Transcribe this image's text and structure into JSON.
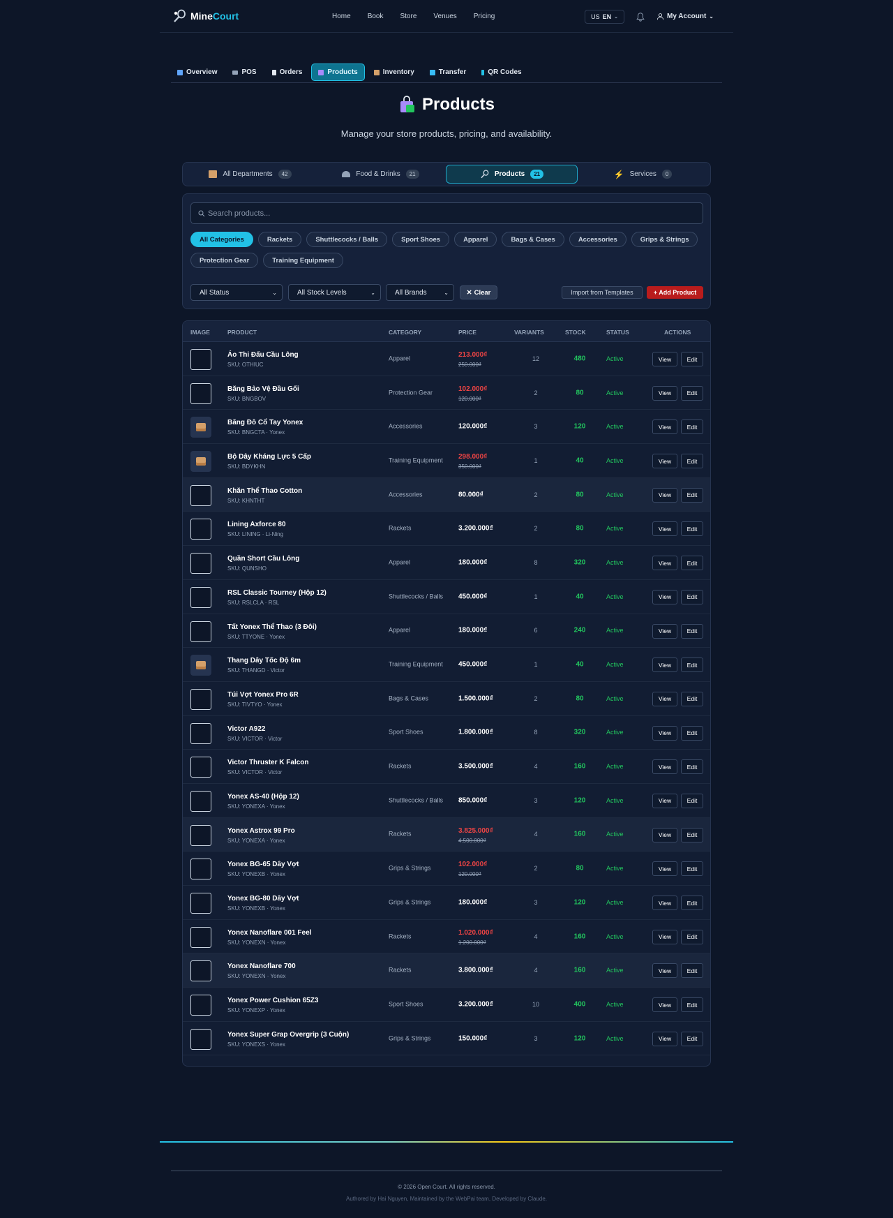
{
  "brand": {
    "name_a": "Mine",
    "name_b": "Court"
  },
  "nav": {
    "links": [
      "Home",
      "Book",
      "Store",
      "Venues",
      "Pricing"
    ],
    "lang_flag": "US",
    "lang": "EN",
    "account": "My Account"
  },
  "subnav": [
    {
      "label": "Overview",
      "color": "#60a5fa"
    },
    {
      "label": "POS",
      "color": "#94a3b8"
    },
    {
      "label": "Orders",
      "color": "#e2e8f0"
    },
    {
      "label": "Products",
      "color": "#a78bfa",
      "active": true
    },
    {
      "label": "Inventory",
      "color": "#d4a06a"
    },
    {
      "label": "Transfer",
      "color": "#38bdf8"
    },
    {
      "label": "QR Codes",
      "color": "#22c1e6"
    }
  ],
  "page": {
    "title": "Products",
    "subtitle": "Manage your store products, pricing, and availability."
  },
  "departments": [
    {
      "label": "All Departments",
      "count": "42"
    },
    {
      "label": "Food & Drinks",
      "count": "21"
    },
    {
      "label": "Products",
      "count": "21",
      "active": true
    },
    {
      "label": "Services",
      "count": "0"
    }
  ],
  "search": {
    "placeholder": "Search products..."
  },
  "categories": [
    "All Categories",
    "Rackets",
    "Shuttlecocks / Balls",
    "Sport Shoes",
    "Apparel",
    "Bags & Cases",
    "Accessories",
    "Grips & Strings",
    "Protection Gear",
    "Training Equipment"
  ],
  "filters": {
    "status": "All Status",
    "stock": "All Stock Levels",
    "brands": "All Brands",
    "clear": "Clear",
    "import": "Import from Templates",
    "add": "+ Add Product"
  },
  "table": {
    "headers": {
      "image": "IMAGE",
      "product": "PRODUCT",
      "category": "CATEGORY",
      "price": "PRICE",
      "variants": "VARIANTS",
      "stock": "STOCK",
      "status": "STATUS",
      "actions": "ACTIONS"
    },
    "view_label": "View",
    "edit_label": "Edit",
    "rows": [
      {
        "name": "Áo Thi Đấu Cầu Lông",
        "sku": "SKU: OTHIUC",
        "category": "Apparel",
        "price": "213.000₫",
        "old_price": "250.000₫",
        "variants": "12",
        "stock": "480",
        "status": "Active",
        "img": "broken"
      },
      {
        "name": "Băng Bảo Vệ Đầu Gối",
        "sku": "SKU: BNGBOV",
        "category": "Protection Gear",
        "price": "102.000₫",
        "old_price": "120.000₫",
        "variants": "2",
        "stock": "80",
        "status": "Active",
        "img": "broken"
      },
      {
        "name": "Băng Đô Cổ Tay Yonex",
        "sku": "SKU: BNGCTA  · Yonex",
        "category": "Accessories",
        "price": "120.000₫",
        "old_price": "",
        "variants": "3",
        "stock": "120",
        "status": "Active",
        "img": "box"
      },
      {
        "name": "Bộ Dây Kháng Lực 5 Cấp",
        "sku": "SKU: BDYKHN",
        "category": "Training Equipment",
        "price": "298.000₫",
        "old_price": "350.000₫",
        "variants": "1",
        "stock": "40",
        "status": "Active",
        "img": "box"
      },
      {
        "name": "Khăn Thể Thao Cotton",
        "sku": "SKU: KHNTHT",
        "category": "Accessories",
        "price": "80.000₫",
        "old_price": "",
        "variants": "2",
        "stock": "80",
        "status": "Active",
        "img": "broken",
        "hl": true
      },
      {
        "name": "Lining Axforce 80",
        "sku": "SKU: LINING  · Li-Ning",
        "category": "Rackets",
        "price": "3.200.000₫",
        "old_price": "",
        "variants": "2",
        "stock": "80",
        "status": "Active",
        "img": "broken"
      },
      {
        "name": "Quần Short Cầu Lông",
        "sku": "SKU: QUNSHO",
        "category": "Apparel",
        "price": "180.000₫",
        "old_price": "",
        "variants": "8",
        "stock": "320",
        "status": "Active",
        "img": "broken"
      },
      {
        "name": "RSL Classic Tourney (Hộp 12)",
        "sku": "SKU: RSLCLA  · RSL",
        "category": "Shuttlecocks / Balls",
        "price": "450.000₫",
        "old_price": "",
        "variants": "1",
        "stock": "40",
        "status": "Active",
        "img": "broken"
      },
      {
        "name": "Tất Yonex Thể Thao (3 Đôi)",
        "sku": "SKU: TTYONE  · Yonex",
        "category": "Apparel",
        "price": "180.000₫",
        "old_price": "",
        "variants": "6",
        "stock": "240",
        "status": "Active",
        "img": "broken"
      },
      {
        "name": "Thang Dây Tốc Độ 6m",
        "sku": "SKU: THANGD  · Victor",
        "category": "Training Equipment",
        "price": "450.000₫",
        "old_price": "",
        "variants": "1",
        "stock": "40",
        "status": "Active",
        "img": "box"
      },
      {
        "name": "Túi Vợt Yonex Pro 6R",
        "sku": "SKU: TIVTYO  · Yonex",
        "category": "Bags & Cases",
        "price": "1.500.000₫",
        "old_price": "",
        "variants": "2",
        "stock": "80",
        "status": "Active",
        "img": "broken"
      },
      {
        "name": "Victor A922",
        "sku": "SKU: VICTOR  · Victor",
        "category": "Sport Shoes",
        "price": "1.800.000₫",
        "old_price": "",
        "variants": "8",
        "stock": "320",
        "status": "Active",
        "img": "broken"
      },
      {
        "name": "Victor Thruster K Falcon",
        "sku": "SKU: VICTOR  · Victor",
        "category": "Rackets",
        "price": "3.500.000₫",
        "old_price": "",
        "variants": "4",
        "stock": "160",
        "status": "Active",
        "img": "broken"
      },
      {
        "name": "Yonex AS-40 (Hộp 12)",
        "sku": "SKU: YONEXA  · Yonex",
        "category": "Shuttlecocks / Balls",
        "price": "850.000₫",
        "old_price": "",
        "variants": "3",
        "stock": "120",
        "status": "Active",
        "img": "broken"
      },
      {
        "name": "Yonex Astrox 99 Pro",
        "sku": "SKU: YONEXA  · Yonex",
        "category": "Rackets",
        "price": "3.825.000₫",
        "old_price": "4.500.000₫",
        "variants": "4",
        "stock": "160",
        "status": "Active",
        "img": "broken",
        "hl": true
      },
      {
        "name": "Yonex BG-65 Dây Vợt",
        "sku": "SKU: YONEXB  · Yonex",
        "category": "Grips & Strings",
        "price": "102.000₫",
        "old_price": "120.000₫",
        "variants": "2",
        "stock": "80",
        "status": "Active",
        "img": "broken"
      },
      {
        "name": "Yonex BG-80 Dây Vợt",
        "sku": "SKU: YONEXB  · Yonex",
        "category": "Grips & Strings",
        "price": "180.000₫",
        "old_price": "",
        "variants": "3",
        "stock": "120",
        "status": "Active",
        "img": "broken"
      },
      {
        "name": "Yonex Nanoflare 001 Feel",
        "sku": "SKU: YONEXN  · Yonex",
        "category": "Rackets",
        "price": "1.020.000₫",
        "old_price": "1.200.000₫",
        "variants": "4",
        "stock": "160",
        "status": "Active",
        "img": "broken"
      },
      {
        "name": "Yonex Nanoflare 700",
        "sku": "SKU: YONEXN  · Yonex",
        "category": "Rackets",
        "price": "3.800.000₫",
        "old_price": "",
        "variants": "4",
        "stock": "160",
        "status": "Active",
        "img": "broken",
        "hl": true
      },
      {
        "name": "Yonex Power Cushion 65Z3",
        "sku": "SKU: YONEXP  · Yonex",
        "category": "Sport Shoes",
        "price": "3.200.000₫",
        "old_price": "",
        "variants": "10",
        "stock": "400",
        "status": "Active",
        "img": "broken"
      },
      {
        "name": "Yonex Super Grap Overgrip (3 Cuộn)",
        "sku": "SKU: YONEXS  · Yonex",
        "category": "Grips & Strings",
        "price": "150.000₫",
        "old_price": "",
        "variants": "3",
        "stock": "120",
        "status": "Active",
        "img": "broken"
      }
    ]
  },
  "footer": {
    "copyright": "© 2026 Open Court. All rights reserved.",
    "authored": "Authored by Hai Nguyen, Maintained by the WebPai team, Developed by Claude."
  }
}
